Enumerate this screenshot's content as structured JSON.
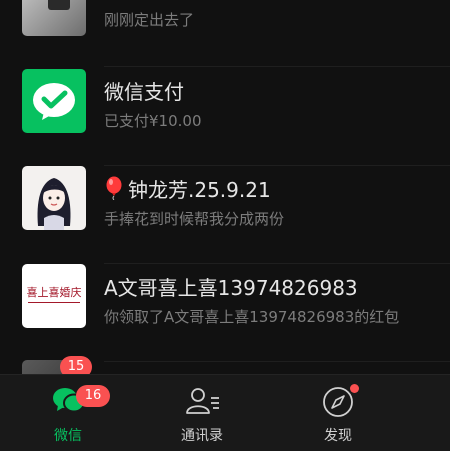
{
  "chats": [
    {
      "name": "",
      "preview": "刚刚定出去了"
    },
    {
      "name": "微信支付",
      "preview": "已支付¥10.00"
    },
    {
      "name": "钟龙芳.25.9.21",
      "preview": "手捧花到时候帮我分成两份"
    },
    {
      "name": "A文哥喜上喜13974826983",
      "preview": "你领取了A文哥喜上喜13974826983的红包",
      "avatar_text": "喜上喜婚庆"
    },
    {
      "name": "",
      "preview": "",
      "unread": "15"
    }
  ],
  "tabs": [
    {
      "label": "微信",
      "badge": "16",
      "active": true,
      "icon": "chat-bubbles-icon"
    },
    {
      "label": "通讯录",
      "active": false,
      "icon": "contacts-icon"
    },
    {
      "label": "发现",
      "active": false,
      "icon": "compass-icon",
      "dot": true
    }
  ],
  "colors": {
    "accent": "#07c160",
    "badge": "#fa5151",
    "background": "#111111",
    "tabbar": "#191919"
  }
}
